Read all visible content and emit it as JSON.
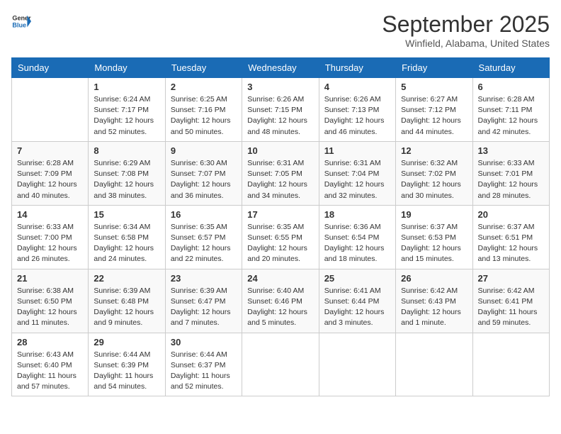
{
  "header": {
    "logo_line1": "General",
    "logo_line2": "Blue",
    "month": "September 2025",
    "location": "Winfield, Alabama, United States"
  },
  "weekdays": [
    "Sunday",
    "Monday",
    "Tuesday",
    "Wednesday",
    "Thursday",
    "Friday",
    "Saturday"
  ],
  "weeks": [
    [
      {
        "day": "",
        "text": ""
      },
      {
        "day": "1",
        "text": "Sunrise: 6:24 AM\nSunset: 7:17 PM\nDaylight: 12 hours\nand 52 minutes."
      },
      {
        "day": "2",
        "text": "Sunrise: 6:25 AM\nSunset: 7:16 PM\nDaylight: 12 hours\nand 50 minutes."
      },
      {
        "day": "3",
        "text": "Sunrise: 6:26 AM\nSunset: 7:15 PM\nDaylight: 12 hours\nand 48 minutes."
      },
      {
        "day": "4",
        "text": "Sunrise: 6:26 AM\nSunset: 7:13 PM\nDaylight: 12 hours\nand 46 minutes."
      },
      {
        "day": "5",
        "text": "Sunrise: 6:27 AM\nSunset: 7:12 PM\nDaylight: 12 hours\nand 44 minutes."
      },
      {
        "day": "6",
        "text": "Sunrise: 6:28 AM\nSunset: 7:11 PM\nDaylight: 12 hours\nand 42 minutes."
      }
    ],
    [
      {
        "day": "7",
        "text": "Sunrise: 6:28 AM\nSunset: 7:09 PM\nDaylight: 12 hours\nand 40 minutes."
      },
      {
        "day": "8",
        "text": "Sunrise: 6:29 AM\nSunset: 7:08 PM\nDaylight: 12 hours\nand 38 minutes."
      },
      {
        "day": "9",
        "text": "Sunrise: 6:30 AM\nSunset: 7:07 PM\nDaylight: 12 hours\nand 36 minutes."
      },
      {
        "day": "10",
        "text": "Sunrise: 6:31 AM\nSunset: 7:05 PM\nDaylight: 12 hours\nand 34 minutes."
      },
      {
        "day": "11",
        "text": "Sunrise: 6:31 AM\nSunset: 7:04 PM\nDaylight: 12 hours\nand 32 minutes."
      },
      {
        "day": "12",
        "text": "Sunrise: 6:32 AM\nSunset: 7:02 PM\nDaylight: 12 hours\nand 30 minutes."
      },
      {
        "day": "13",
        "text": "Sunrise: 6:33 AM\nSunset: 7:01 PM\nDaylight: 12 hours\nand 28 minutes."
      }
    ],
    [
      {
        "day": "14",
        "text": "Sunrise: 6:33 AM\nSunset: 7:00 PM\nDaylight: 12 hours\nand 26 minutes."
      },
      {
        "day": "15",
        "text": "Sunrise: 6:34 AM\nSunset: 6:58 PM\nDaylight: 12 hours\nand 24 minutes."
      },
      {
        "day": "16",
        "text": "Sunrise: 6:35 AM\nSunset: 6:57 PM\nDaylight: 12 hours\nand 22 minutes."
      },
      {
        "day": "17",
        "text": "Sunrise: 6:35 AM\nSunset: 6:55 PM\nDaylight: 12 hours\nand 20 minutes."
      },
      {
        "day": "18",
        "text": "Sunrise: 6:36 AM\nSunset: 6:54 PM\nDaylight: 12 hours\nand 18 minutes."
      },
      {
        "day": "19",
        "text": "Sunrise: 6:37 AM\nSunset: 6:53 PM\nDaylight: 12 hours\nand 15 minutes."
      },
      {
        "day": "20",
        "text": "Sunrise: 6:37 AM\nSunset: 6:51 PM\nDaylight: 12 hours\nand 13 minutes."
      }
    ],
    [
      {
        "day": "21",
        "text": "Sunrise: 6:38 AM\nSunset: 6:50 PM\nDaylight: 12 hours\nand 11 minutes."
      },
      {
        "day": "22",
        "text": "Sunrise: 6:39 AM\nSunset: 6:48 PM\nDaylight: 12 hours\nand 9 minutes."
      },
      {
        "day": "23",
        "text": "Sunrise: 6:39 AM\nSunset: 6:47 PM\nDaylight: 12 hours\nand 7 minutes."
      },
      {
        "day": "24",
        "text": "Sunrise: 6:40 AM\nSunset: 6:46 PM\nDaylight: 12 hours\nand 5 minutes."
      },
      {
        "day": "25",
        "text": "Sunrise: 6:41 AM\nSunset: 6:44 PM\nDaylight: 12 hours\nand 3 minutes."
      },
      {
        "day": "26",
        "text": "Sunrise: 6:42 AM\nSunset: 6:43 PM\nDaylight: 12 hours\nand 1 minute."
      },
      {
        "day": "27",
        "text": "Sunrise: 6:42 AM\nSunset: 6:41 PM\nDaylight: 11 hours\nand 59 minutes."
      }
    ],
    [
      {
        "day": "28",
        "text": "Sunrise: 6:43 AM\nSunset: 6:40 PM\nDaylight: 11 hours\nand 57 minutes."
      },
      {
        "day": "29",
        "text": "Sunrise: 6:44 AM\nSunset: 6:39 PM\nDaylight: 11 hours\nand 54 minutes."
      },
      {
        "day": "30",
        "text": "Sunrise: 6:44 AM\nSunset: 6:37 PM\nDaylight: 11 hours\nand 52 minutes."
      },
      {
        "day": "",
        "text": ""
      },
      {
        "day": "",
        "text": ""
      },
      {
        "day": "",
        "text": ""
      },
      {
        "day": "",
        "text": ""
      }
    ]
  ]
}
